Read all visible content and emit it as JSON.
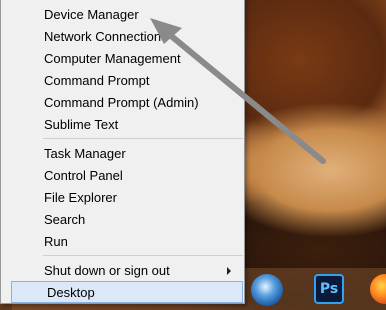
{
  "menu": {
    "items": [
      {
        "label": "Device Manager"
      },
      {
        "label": "Network Connections"
      },
      {
        "label": "Computer Management"
      },
      {
        "label": "Command Prompt"
      },
      {
        "label": "Command Prompt (Admin)"
      },
      {
        "label": "Sublime Text"
      },
      {
        "label": "Task Manager"
      },
      {
        "label": "Control Panel"
      },
      {
        "label": "File Explorer"
      },
      {
        "label": "Search"
      },
      {
        "label": "Run"
      },
      {
        "label": "Shut down or sign out",
        "has_submenu": true
      },
      {
        "label": "Desktop",
        "highlighted": true
      }
    ]
  },
  "taskbar": {
    "icons": [
      {
        "name": "thunderbird-icon"
      },
      {
        "name": "photoshop-icon",
        "text": "Ps"
      },
      {
        "name": "firefox-icon"
      }
    ]
  },
  "colors": {
    "menu_bg": "#f0f0f0",
    "highlight_bg": "#dbe8f7",
    "highlight_border": "#8bb1df",
    "annotation_arrow": "#8a8a8a"
  }
}
